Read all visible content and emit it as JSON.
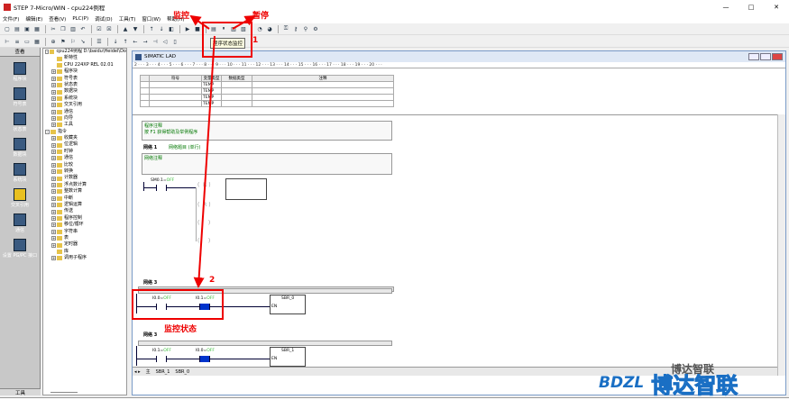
{
  "window": {
    "title": "STEP 7-Micro/WIN - cpu224例程",
    "min": "—",
    "max": "□",
    "close": "✕"
  },
  "menu": [
    "文件(F)",
    "编辑(E)",
    "查看(V)",
    "PLC(P)",
    "调试(D)",
    "工具(T)",
    "窗口(W)",
    "帮助(H)"
  ],
  "toolbar": {
    "tooltip": "程序状态监控"
  },
  "nav": {
    "header": "查看",
    "items": [
      "程序块",
      "符号表",
      "状态表",
      "数据块",
      "系统块",
      "交叉引用",
      "通信",
      "设置 PG/PC 接口"
    ],
    "footer": "工具"
  },
  "tree": {
    "rows": [
      {
        "t": "cpu224例程 D:\\baidu\\Heidel\\Do",
        "ex": "-",
        "ind": 0
      },
      {
        "t": "新特性",
        "ex": "",
        "ind": 1
      },
      {
        "t": "CPU 224XP REL 02.01",
        "ex": "",
        "ind": 1
      },
      {
        "t": "程序块",
        "ex": "+",
        "ind": 1
      },
      {
        "t": "符号表",
        "ex": "+",
        "ind": 1
      },
      {
        "t": "状态表",
        "ex": "+",
        "ind": 1
      },
      {
        "t": "数据块",
        "ex": "+",
        "ind": 1
      },
      {
        "t": "系统块",
        "ex": "+",
        "ind": 1
      },
      {
        "t": "交叉引用",
        "ex": "+",
        "ind": 1
      },
      {
        "t": "通信",
        "ex": "+",
        "ind": 1
      },
      {
        "t": "向导",
        "ex": "+",
        "ind": 1
      },
      {
        "t": "工具",
        "ex": "+",
        "ind": 1
      },
      {
        "t": "指令",
        "ex": "-",
        "ind": 0
      },
      {
        "t": "收藏夹",
        "ex": "+",
        "ind": 1
      },
      {
        "t": "位逻辑",
        "ex": "+",
        "ind": 1
      },
      {
        "t": "时钟",
        "ex": "+",
        "ind": 1
      },
      {
        "t": "通信",
        "ex": "+",
        "ind": 1
      },
      {
        "t": "比较",
        "ex": "+",
        "ind": 1
      },
      {
        "t": "转换",
        "ex": "+",
        "ind": 1
      },
      {
        "t": "计数器",
        "ex": "+",
        "ind": 1
      },
      {
        "t": "浮点数计算",
        "ex": "+",
        "ind": 1
      },
      {
        "t": "整数计算",
        "ex": "+",
        "ind": 1
      },
      {
        "t": "中断",
        "ex": "+",
        "ind": 1
      },
      {
        "t": "逻辑运算",
        "ex": "+",
        "ind": 1
      },
      {
        "t": "传送",
        "ex": "+",
        "ind": 1
      },
      {
        "t": "程序控制",
        "ex": "+",
        "ind": 1
      },
      {
        "t": "移位/循环",
        "ex": "+",
        "ind": 1
      },
      {
        "t": "字符串",
        "ex": "+",
        "ind": 1
      },
      {
        "t": "表",
        "ex": "+",
        "ind": 1
      },
      {
        "t": "定时器",
        "ex": "+",
        "ind": 1
      },
      {
        "t": "库",
        "ex": "",
        "ind": 1
      },
      {
        "t": "调用子程序",
        "ex": "+",
        "ind": 1
      }
    ]
  },
  "lad": {
    "title": "SIMATIC LAD",
    "ruler": "2 · · · 3 · · · 4 · · · 5 · · · 6 · · · 7 · · · 8 · · · 9 · · · 10 · · · 11 · · · 12 · · · 13 · · · 14 · · · 15 · · · 16 · · · 17 · · · 18 · · · 19 · · · 20 · · ·",
    "var_headers": [
      "",
      "符号",
      "变量类型",
      "数据类型",
      "注释"
    ],
    "var_rows": [
      "TEMP",
      "TEMP",
      "TEMP",
      "TEMP"
    ],
    "prog_comment_1": "程序注释",
    "prog_comment_2": "按 F1 获得帮助及举例程序",
    "net1_label": "网络 1",
    "net1_title": "网络题目 (单行)",
    "net1_comment": "网络注释",
    "net1_contact": "SM0.1=",
    "net1_contact_state": "OFF",
    "net3a_label": "网络 3",
    "net3a_c1": "I0.0=",
    "net3a_c1_state": "OFF",
    "net3a_c2": "I0.1=",
    "net3a_c2_state": "OFF",
    "net3a_block": "SBR_0",
    "en": "EN",
    "net3b_label": "网络 3",
    "net3b_c1": "I0.1=",
    "net3b_c1_state": "OFF",
    "net3b_c2": "I0.0=",
    "net3b_c2_state": "OFF",
    "net3b_block": "SBR_1",
    "tabs": [
      "主",
      "SBR_1",
      "SBR_0"
    ]
  },
  "annotations": {
    "monitor": "监控",
    "pause": "暂停",
    "num1": "1",
    "num2": "2",
    "monitor_state": "监控状态"
  },
  "watermark": {
    "logo": "BDZL",
    "cn": "博达智联",
    "small": "博达智联"
  },
  "colors": {
    "annotation": "#e00000",
    "on_contact": "#0033cc",
    "status_text": "#33bb33"
  }
}
